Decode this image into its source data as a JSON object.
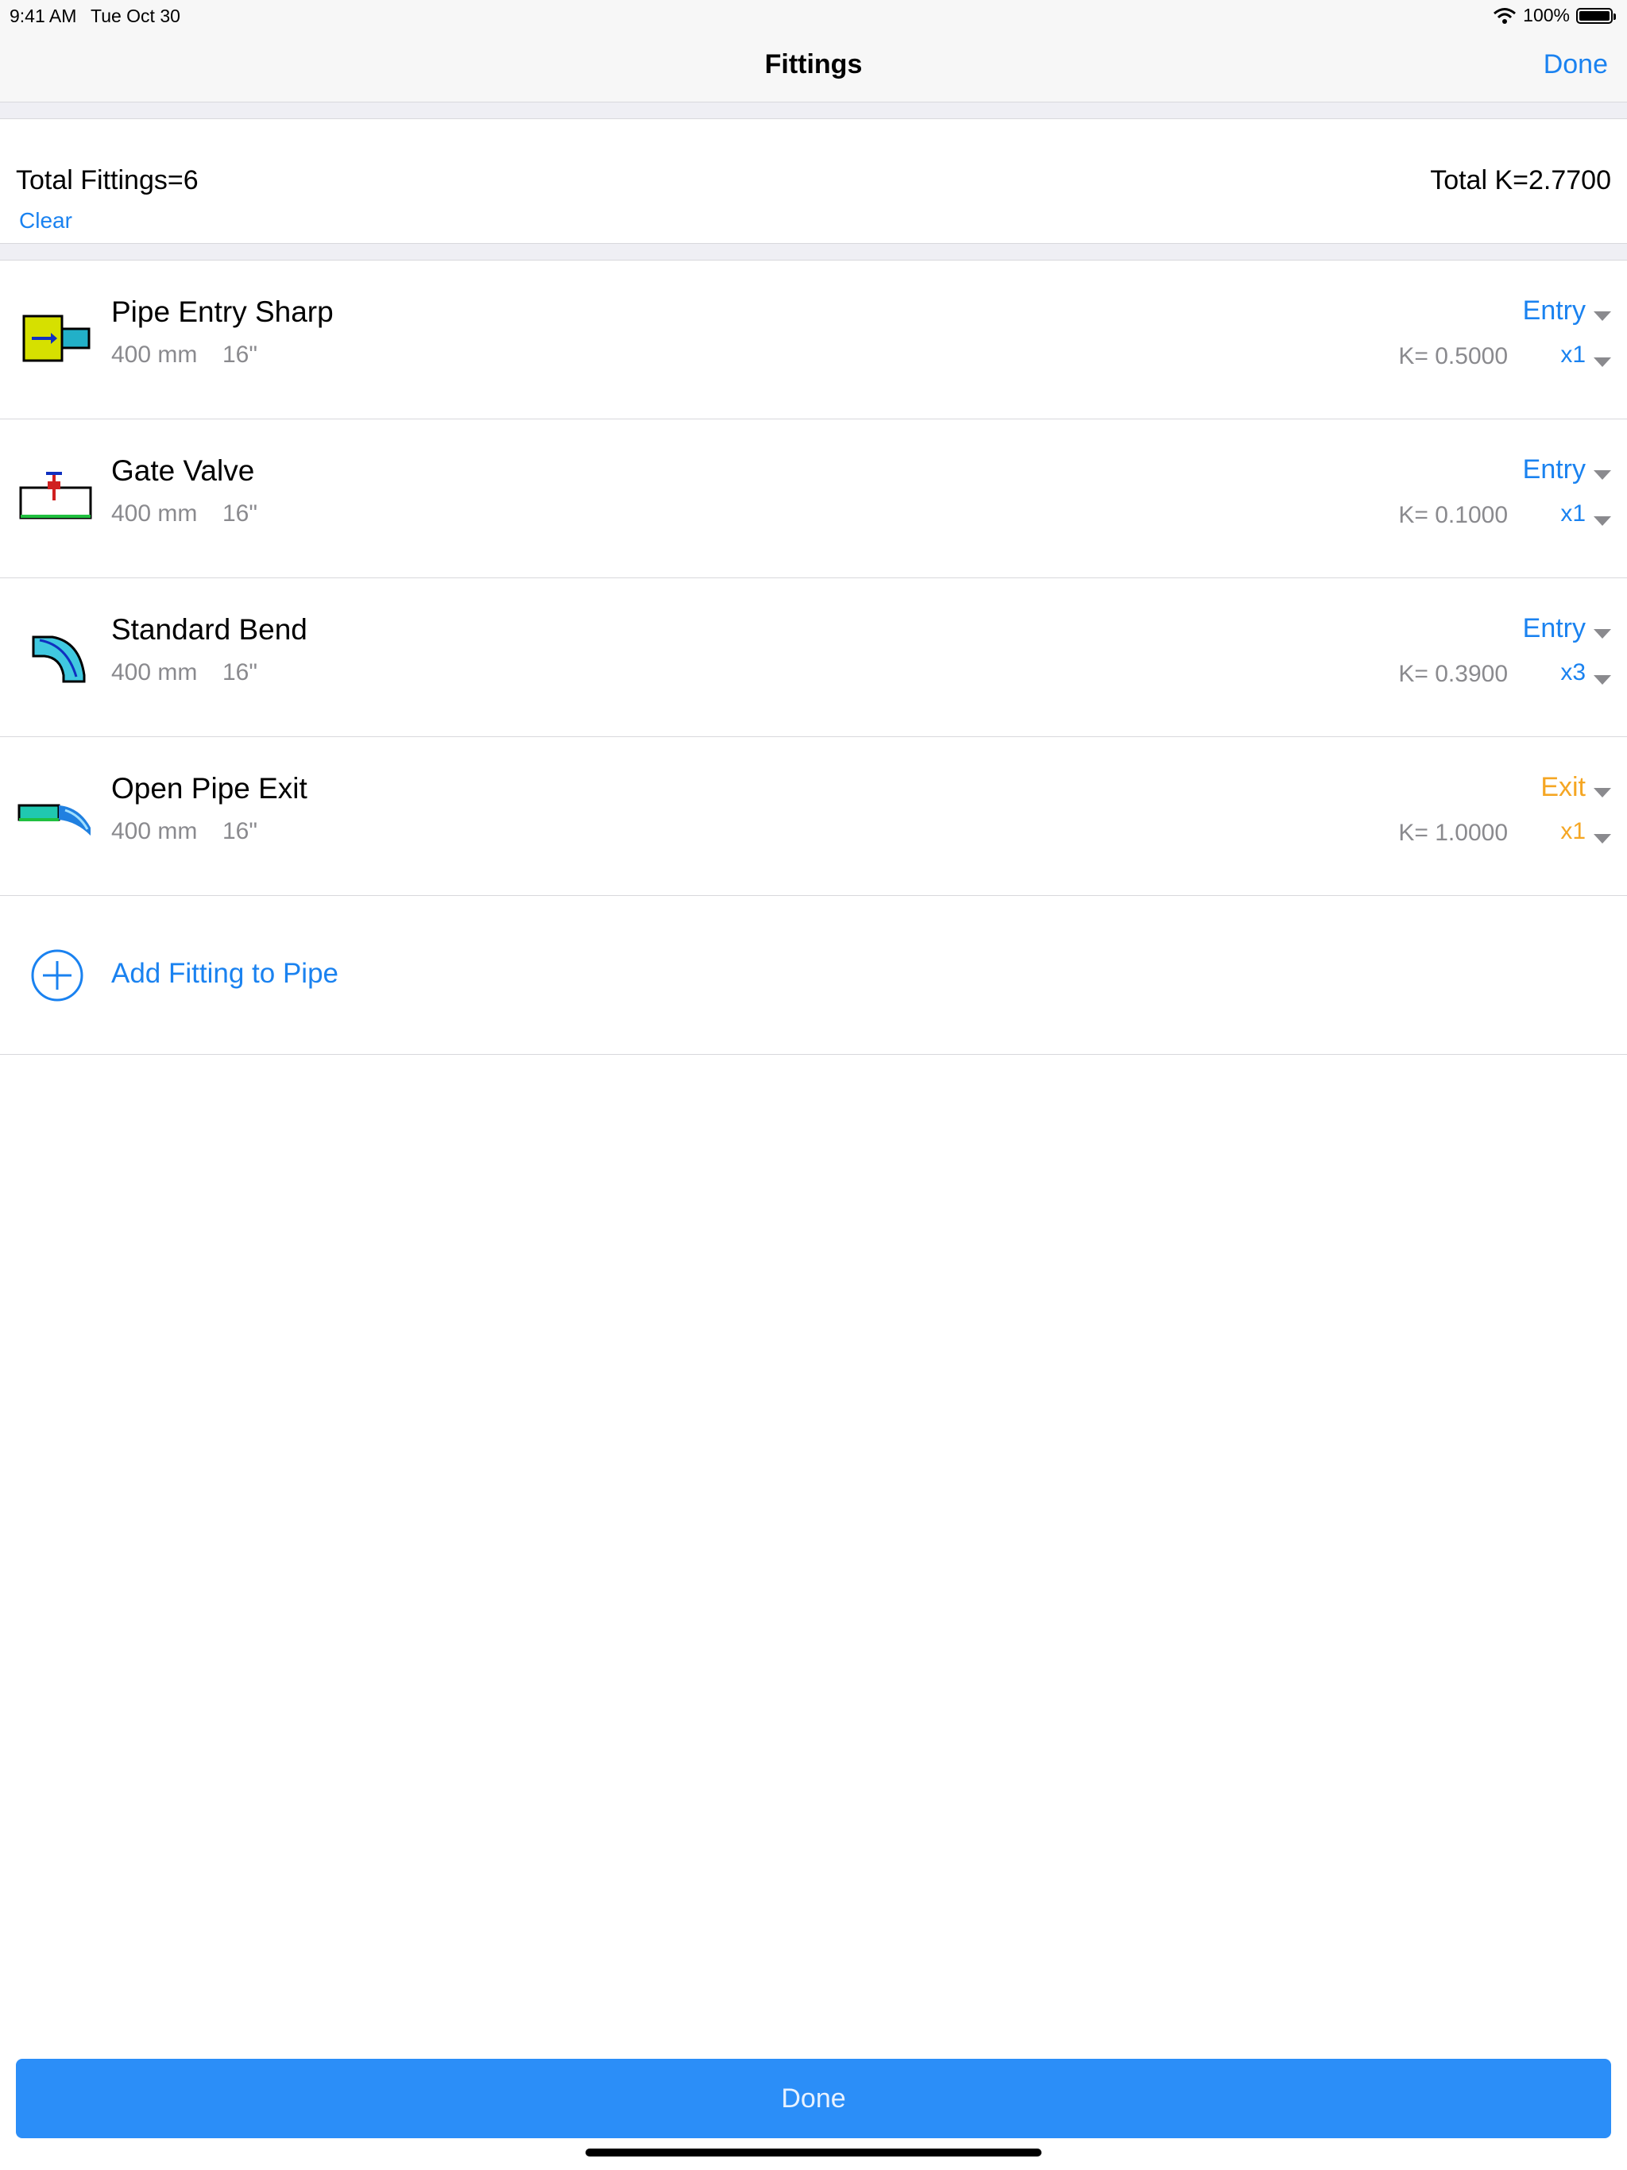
{
  "status_bar": {
    "time": "9:41 AM",
    "date": "Tue Oct 30",
    "battery": "100%",
    "battery_level": 1.0
  },
  "nav": {
    "title": "Fittings",
    "done_label": "Done"
  },
  "summary": {
    "total_fittings": "Total Fittings=6",
    "total_k": "Total K=2.7700",
    "clear_label": "Clear"
  },
  "colors": {
    "accent": "#1a82f0",
    "exit": "#f5a623",
    "secondary_text": "#8a8a8e",
    "done_button": "#2b8ef8"
  },
  "fittings": [
    {
      "name": "Pipe Entry Sharp",
      "size_mm": "400 mm",
      "size_in": "16\"",
      "type": "Entry",
      "k": "K= 0.5000",
      "multiplier": "x1",
      "icon": "pipe-entry-sharp-icon"
    },
    {
      "name": "Gate Valve",
      "size_mm": "400 mm",
      "size_in": "16\"",
      "type": "Entry",
      "k": "K= 0.1000",
      "multiplier": "x1",
      "icon": "gate-valve-icon"
    },
    {
      "name": "Standard Bend",
      "size_mm": "400 mm",
      "size_in": "16\"",
      "type": "Entry",
      "k": "K= 0.3900",
      "multiplier": "x3",
      "icon": "standard-bend-icon"
    },
    {
      "name": "Open Pipe Exit",
      "size_mm": "400 mm",
      "size_in": "16\"",
      "type": "Exit",
      "k": "K= 1.0000",
      "multiplier": "x1",
      "icon": "open-pipe-exit-icon"
    }
  ],
  "add_fitting": {
    "label": "Add Fitting to Pipe"
  },
  "footer": {
    "done_label": "Done"
  }
}
